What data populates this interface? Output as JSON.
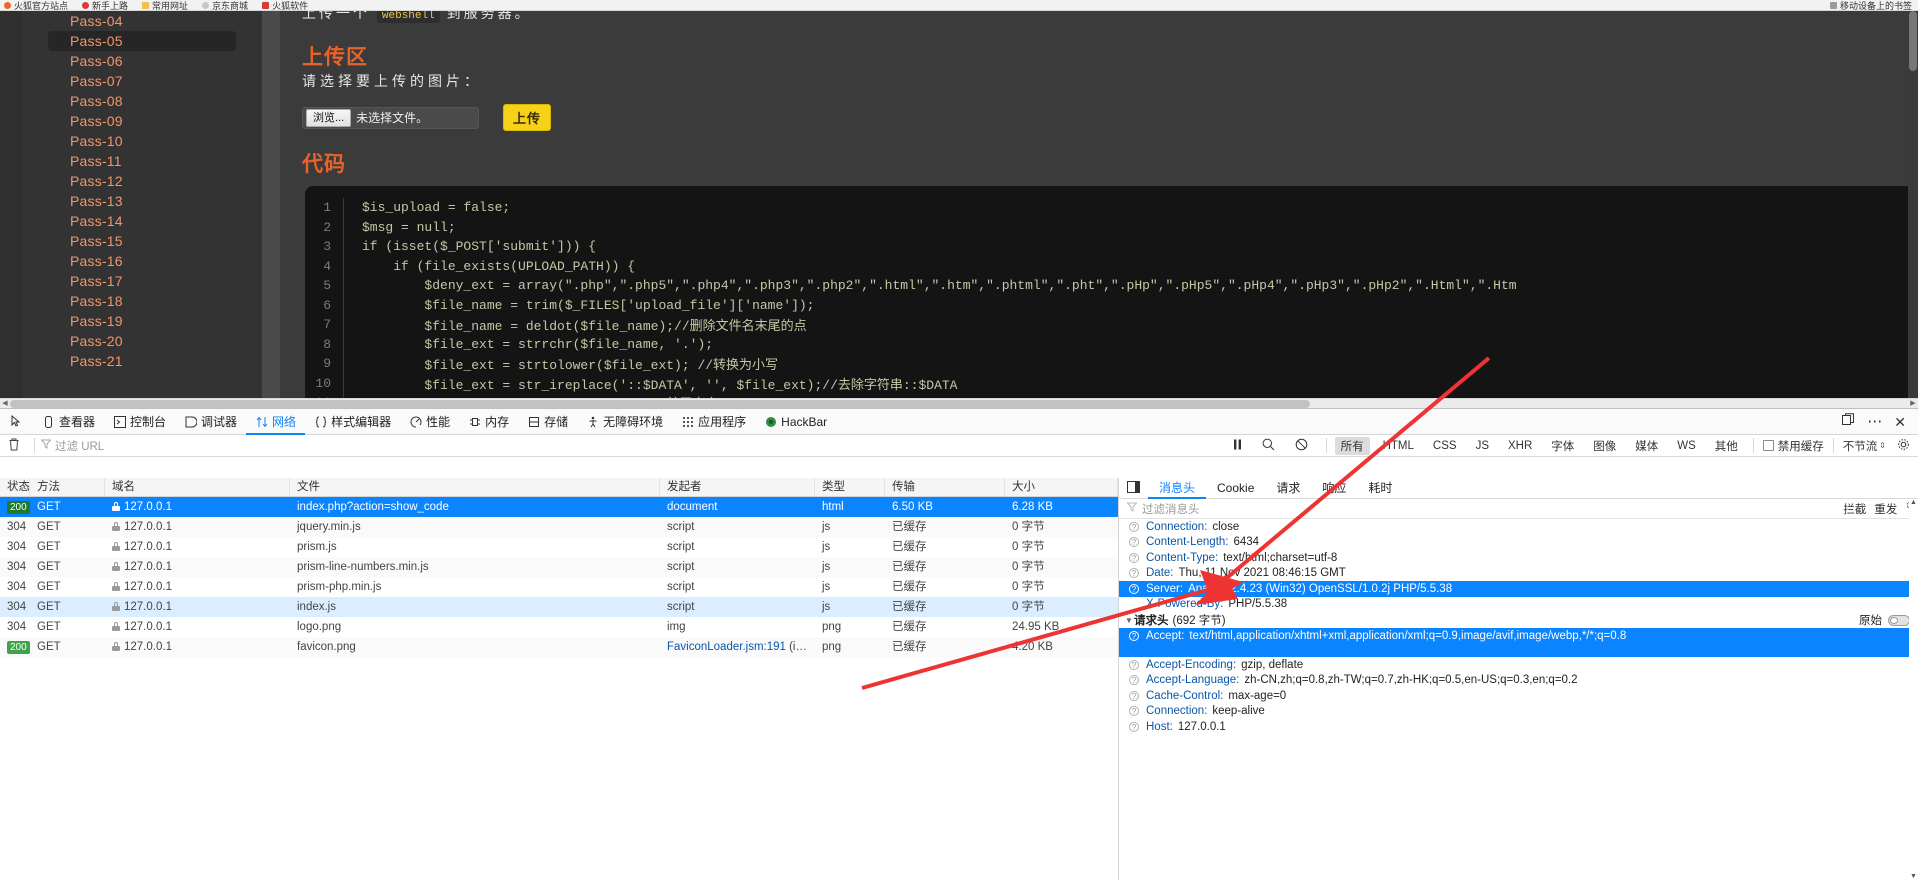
{
  "browser": {
    "bookmarks": [
      {
        "label": "火狐官方站点",
        "icon": "firefox-icon",
        "color": "#e8662a"
      },
      {
        "label": "新手上路",
        "icon": "globe-icon",
        "color": "#d43d3d"
      },
      {
        "label": "常用网址",
        "icon": "folder-icon",
        "color": "#f0c14b"
      },
      {
        "label": "京东商城",
        "icon": "jd-icon",
        "color": "#c8c8c8"
      },
      {
        "label": "火狐软件",
        "icon": "red-square-icon",
        "color": "#d43d3d"
      }
    ],
    "right_label": "移动设备上的书签"
  },
  "page": {
    "sidebar_items": [
      {
        "label": "Pass-04",
        "active": false
      },
      {
        "label": "Pass-05",
        "active": true
      },
      {
        "label": "Pass-06",
        "active": false
      },
      {
        "label": "Pass-07",
        "active": false
      },
      {
        "label": "Pass-08",
        "active": false
      },
      {
        "label": "Pass-09",
        "active": false
      },
      {
        "label": "Pass-10",
        "active": false
      },
      {
        "label": "Pass-11",
        "active": false
      },
      {
        "label": "Pass-12",
        "active": false
      },
      {
        "label": "Pass-13",
        "active": false
      },
      {
        "label": "Pass-14",
        "active": false
      },
      {
        "label": "Pass-15",
        "active": false
      },
      {
        "label": "Pass-16",
        "active": false
      },
      {
        "label": "Pass-17",
        "active": false
      },
      {
        "label": "Pass-18",
        "active": false
      },
      {
        "label": "Pass-19",
        "active": false
      },
      {
        "label": "Pass-20",
        "active": false
      },
      {
        "label": "Pass-21",
        "active": false
      }
    ],
    "intro_prefix": "上传一个 ",
    "intro_code": "webshell",
    "intro_suffix": " 到服务器。",
    "upload_section_title": "上传区",
    "upload_prompt": "请选择要上传的图片：",
    "browse_button": "浏览...",
    "no_file_text": "未选择文件。",
    "upload_button": "上传",
    "code_section_title": "代码",
    "code_lines": [
      {
        "n": "1",
        "text": "$is_upload = false;"
      },
      {
        "n": "2",
        "text": "$msg = null;"
      },
      {
        "n": "3",
        "text": "if (isset($_POST['submit'])) {"
      },
      {
        "n": "4",
        "text": "    if (file_exists(UPLOAD_PATH)) {"
      },
      {
        "n": "5",
        "text": "        $deny_ext = array(\".php\",\".php5\",\".php4\",\".php3\",\".php2\",\".html\",\".htm\",\".phtml\",\".pht\",\".pHp\",\".pHp5\",\".pHp4\",\".pHp3\",\".pHp2\",\".Html\",\".Htm"
      },
      {
        "n": "6",
        "text": "        $file_name = trim($_FILES['upload_file']['name']);"
      },
      {
        "n": "7",
        "text": "        $file_name = deldot($file_name);//删除文件名末尾的点"
      },
      {
        "n": "8",
        "text": "        $file_ext = strrchr($file_name, '.');"
      },
      {
        "n": "9",
        "text": "        $file_ext = strtolower($file_ext); //转换为小写"
      },
      {
        "n": "10",
        "text": "        $file_ext = str_ireplace('::$DATA', '', $file_ext);//去除字符串::$DATA"
      },
      {
        "n": "11",
        "text": "        $file_ext = trim($file_ext); //首尾去空"
      }
    ]
  },
  "devtools": {
    "tabs": [
      {
        "label": "查看器",
        "icon": "inspector-icon",
        "active": false
      },
      {
        "label": "控制台",
        "icon": "console-icon",
        "active": false
      },
      {
        "label": "调试器",
        "icon": "debugger-icon",
        "active": false
      },
      {
        "label": "网络",
        "icon": "network-icon",
        "active": true
      },
      {
        "label": "样式编辑器",
        "icon": "style-editor-icon",
        "active": false
      },
      {
        "label": "性能",
        "icon": "performance-icon",
        "active": false
      },
      {
        "label": "内存",
        "icon": "memory-icon",
        "active": false
      },
      {
        "label": "存储",
        "icon": "storage-icon",
        "active": false
      },
      {
        "label": "无障碍环境",
        "icon": "accessibility-icon",
        "active": false
      },
      {
        "label": "应用程序",
        "icon": "application-icon",
        "active": false
      },
      {
        "label": "HackBar",
        "icon": "hackbar-icon",
        "active": false
      }
    ],
    "window_buttons": [
      {
        "name": "dock-icon",
        "glyph": "⧉"
      },
      {
        "name": "more-options-icon",
        "glyph": "⋯"
      },
      {
        "name": "close-icon",
        "glyph": "✕"
      }
    ],
    "filterbar": {
      "trash_icon": "trash-icon",
      "filter_placeholder": "过滤 URL",
      "pause_icon": "pause-icon",
      "search_icon": "search-icon",
      "block_icon": "block-icon",
      "type_filters": [
        {
          "label": "所有",
          "selected": true
        },
        {
          "label": "HTML",
          "selected": false
        },
        {
          "label": "CSS",
          "selected": false
        },
        {
          "label": "JS",
          "selected": false
        },
        {
          "label": "XHR",
          "selected": false
        },
        {
          "label": "字体",
          "selected": false
        },
        {
          "label": "图像",
          "selected": false
        },
        {
          "label": "媒体",
          "selected": false
        },
        {
          "label": "WS",
          "selected": false
        },
        {
          "label": "其他",
          "selected": false
        }
      ],
      "disable_cache": "禁用缓存",
      "throttle": "不节流",
      "gear_icon": "gear-icon"
    },
    "table_headers": [
      "状态",
      "方法",
      "域名",
      "文件",
      "发起者",
      "类型",
      "传输",
      "大小"
    ],
    "rows": [
      {
        "status": "200",
        "badge": true,
        "method": "GET",
        "domain": "127.0.0.1",
        "file": "index.php?action=show_code",
        "cause": "document",
        "cause_link": false,
        "type": "html",
        "transfer": "6.50 KB",
        "size": "6.28 KB",
        "state": "selected"
      },
      {
        "status": "304",
        "badge": false,
        "method": "GET",
        "domain": "127.0.0.1",
        "file": "jquery.min.js",
        "cause": "script",
        "cause_link": false,
        "type": "js",
        "transfer": "已缓存",
        "size": "0 字节",
        "state": "odd"
      },
      {
        "status": "304",
        "badge": false,
        "method": "GET",
        "domain": "127.0.0.1",
        "file": "prism.js",
        "cause": "script",
        "cause_link": false,
        "type": "js",
        "transfer": "已缓存",
        "size": "0 字节",
        "state": ""
      },
      {
        "status": "304",
        "badge": false,
        "method": "GET",
        "domain": "127.0.0.1",
        "file": "prism-line-numbers.min.js",
        "cause": "script",
        "cause_link": false,
        "type": "js",
        "transfer": "已缓存",
        "size": "0 字节",
        "state": "odd"
      },
      {
        "status": "304",
        "badge": false,
        "method": "GET",
        "domain": "127.0.0.1",
        "file": "prism-php.min.js",
        "cause": "script",
        "cause_link": false,
        "type": "js",
        "transfer": "已缓存",
        "size": "0 字节",
        "state": ""
      },
      {
        "status": "304",
        "badge": false,
        "method": "GET",
        "domain": "127.0.0.1",
        "file": "index.js",
        "cause": "script",
        "cause_link": false,
        "type": "js",
        "transfer": "已缓存",
        "size": "0 字节",
        "state": "hl"
      },
      {
        "status": "304",
        "badge": false,
        "method": "GET",
        "domain": "127.0.0.1",
        "file": "logo.png",
        "cause": "img",
        "cause_link": false,
        "type": "png",
        "transfer": "已缓存",
        "size": "24.95 KB",
        "state": ""
      },
      {
        "status": "200",
        "badge": true,
        "method": "GET",
        "domain": "127.0.0.1",
        "file": "favicon.png",
        "cause": "FaviconLoader.jsm:191",
        "cause_suffix": " (img)",
        "cause_link": true,
        "type": "png",
        "transfer": "已缓存",
        "size": "4.20 KB",
        "state": "odd"
      }
    ],
    "detail": {
      "tabs": [
        {
          "label": "消息头",
          "active": true
        },
        {
          "label": "Cookie",
          "active": false
        },
        {
          "label": "请求",
          "active": false
        },
        {
          "label": "响应",
          "active": false
        },
        {
          "label": "耗时",
          "active": false
        }
      ],
      "expand_icon": "expand-panel-icon",
      "header_filter_placeholder": "过滤消息头",
      "block_label": "拦截",
      "resend_label": "重发",
      "response_headers": [
        {
          "name": "Connection:",
          "value": "close",
          "selected": false
        },
        {
          "name": "Content-Length:",
          "value": "6434",
          "selected": false
        },
        {
          "name": "Content-Type:",
          "value": "text/html;charset=utf-8",
          "selected": false
        },
        {
          "name": "Date:",
          "value": "Thu, 11 Nov 2021 08:46:15 GMT",
          "selected": false
        },
        {
          "name": "Server:",
          "value": "Apache/2.4.23 (Win32) OpenSSL/1.0.2j PHP/5.5.38",
          "selected": true
        },
        {
          "name": "X-Powered-By:",
          "value": "PHP/5.5.38",
          "selected": false,
          "no_icon": true
        }
      ],
      "request_group_label": "请求头",
      "request_group_count": "(692 字节)",
      "raw_label": "原始",
      "request_headers": [
        {
          "name": "Accept:",
          "value": "text/html,application/xhtml+xml,application/xml;q=0.9,image/avif,image/webp,*/*;q=0.8",
          "selected": true,
          "wrap": true
        },
        {
          "name": "Accept-Encoding:",
          "value": "gzip, deflate",
          "selected": false
        },
        {
          "name": "Accept-Language:",
          "value": "zh-CN,zh;q=0.8,zh-TW;q=0.7,zh-HK;q=0.5,en-US;q=0.3,en;q=0.2",
          "selected": false
        },
        {
          "name": "Cache-Control:",
          "value": "max-age=0",
          "selected": false
        },
        {
          "name": "Connection:",
          "value": "keep-alive",
          "selected": false
        },
        {
          "name": "Host:",
          "value": "127.0.0.1",
          "selected": false
        }
      ]
    }
  },
  "annotation": {
    "arrow_color": "#ee3333",
    "arrow_name": "red-arrow-annotation"
  }
}
